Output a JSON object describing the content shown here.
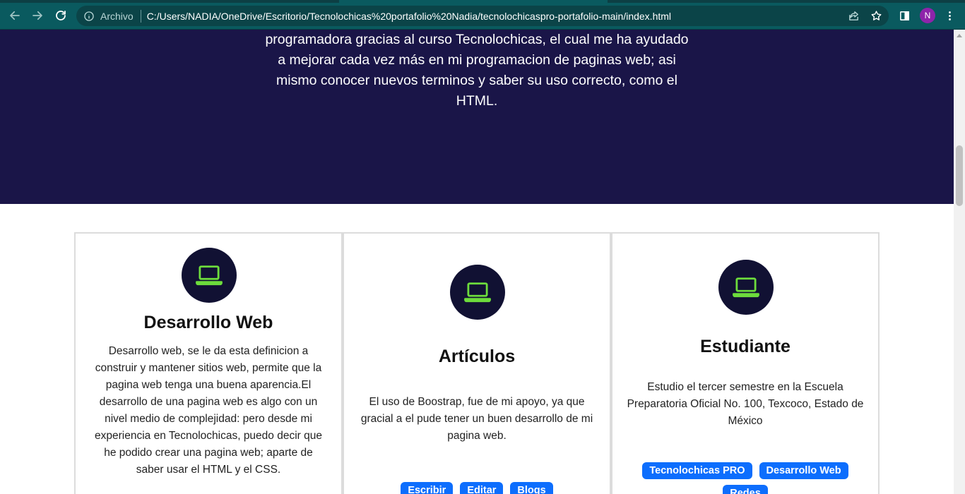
{
  "browser": {
    "scheme_label": "Archivo",
    "url": "C:/Users/NADIA/OneDrive/Escritorio/Tecnolochicas%20portafolio%20Nadia/tecnolochicaspro-portafolio-main/index.html",
    "profile_initial": "N",
    "colors": {
      "toolbar": "#0a5a5f",
      "omnibox": "#0b4448",
      "avatar": "#8e24aa"
    }
  },
  "hero": {
    "text": "programadora gracias al curso Tecnolochicas, el cual me ha ayudado a mejorar cada vez más en mi programacion de paginas web; asi mismo conocer nuevos terminos y saber su uso correcto, como el HTML.",
    "background": "#1a1548"
  },
  "cards": [
    {
      "icon": "laptop-icon",
      "title": "Desarrollo Web",
      "description": "Desarrollo web, se le da esta definicion a construir y mantener sitios web, permite que la pagina web tenga una buena aparencia.El desarrollo de una pagina web es algo con un nivel medio de complejidad: pero desde mi experiencia en Tecnolochicas, puedo decir que he podido crear una pagina web; aparte de saber usar el HTML y el CSS.",
      "badges": []
    },
    {
      "icon": "laptop-icon",
      "title": "Artículos",
      "description": "El uso de Boostrap, fue de mi apoyo, ya que gracial a el pude tener un buen desarrollo de mi pagina web.",
      "badges": [
        "Escribir",
        "Editar",
        "Blogs"
      ]
    },
    {
      "icon": "laptop-icon",
      "title": "Estudiante",
      "description": "Estudio el tercer semestre en la Escuela Preparatoria Oficial No. 100, Texcoco, Estado de México",
      "badges": [
        "Tecnolochicas PRO",
        "Desarrollo Web",
        "Redes"
      ]
    }
  ],
  "colors": {
    "icon_circle": "#111133",
    "icon_stroke": "#6ddc3c",
    "badge": "#0d6efd"
  }
}
